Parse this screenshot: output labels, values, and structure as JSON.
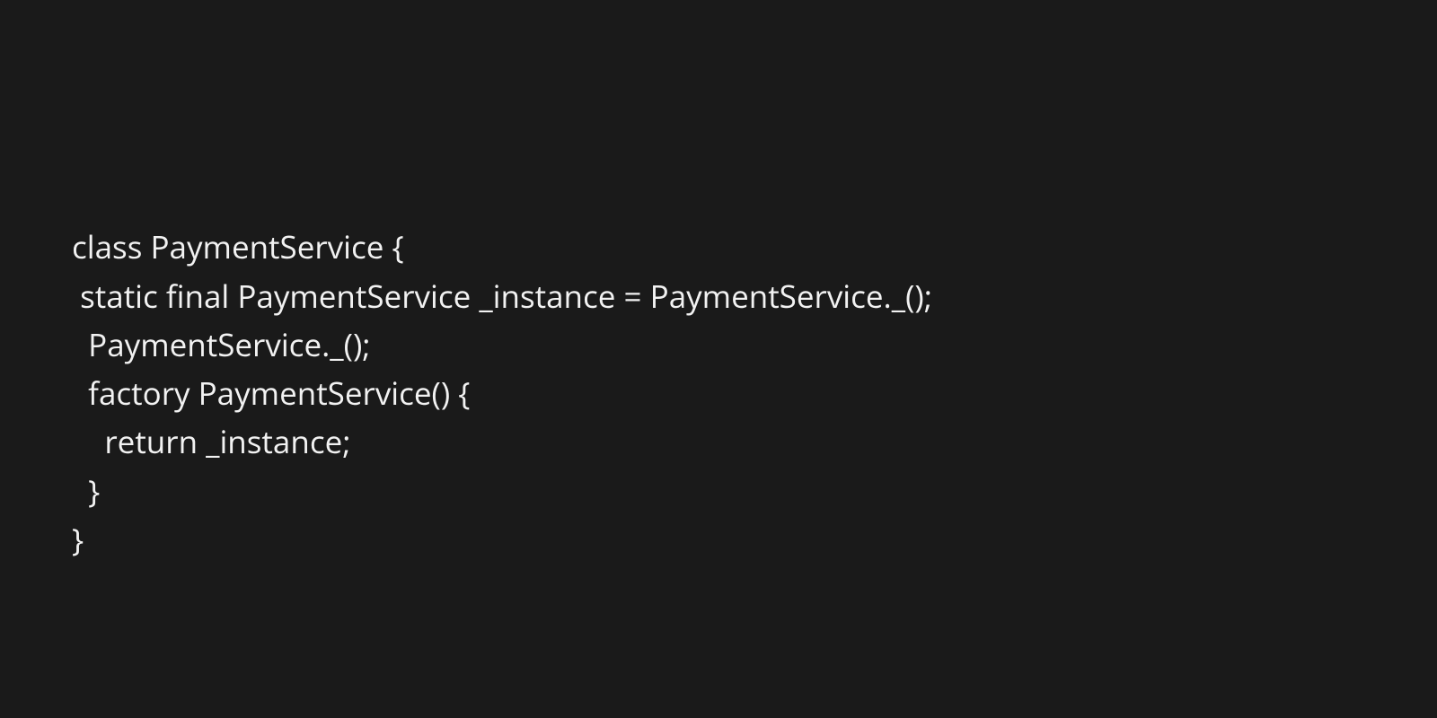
{
  "code": {
    "line1": "class PaymentService {",
    "line2": " static final PaymentService _instance = PaymentService._();",
    "line3": "  PaymentService._();",
    "line4": "  factory PaymentService() {",
    "line5": "    return _instance;",
    "line6": "  }",
    "line7": "}"
  }
}
